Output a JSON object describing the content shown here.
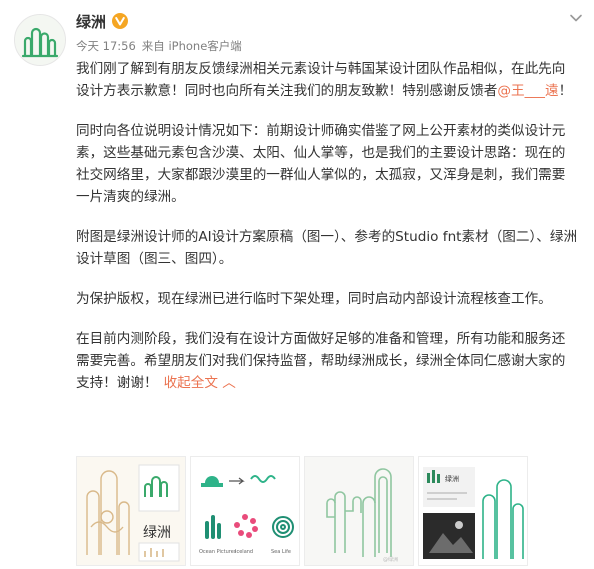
{
  "post": {
    "author": "绿洲",
    "verified_icon": "verified-v-icon",
    "time": "今天 17:56",
    "source": "来自 iPhone客户端",
    "paragraphs": [
      {
        "before": "我们刚了解到有朋友反馈绿洲相关元素设计与韩国某设计团队作品相似，在此先向设计方表示歉意！同时也向所有关注我们的朋友致歉！特别感谢反馈者",
        "mention": "@王___遠",
        "after": "！"
      },
      {
        "text": "同时向各位说明设计情况如下：前期设计师确实借鉴了网上公开素材的类似设计元素，这些基础元素包含沙漠、太阳、仙人掌等，也是我们的主要设计思路：现在的社交网络里，大家都跟沙漠里的一群仙人掌似的，太孤寂，又浑身是刺，我们需要一片清爽的绿洲。"
      },
      {
        "text": "附图是绿洲设计师的AI设计方案原稿（图一）、参考的Studio fnt素材（图二）、绿洲设计草图（图三、图四）。"
      },
      {
        "text": "为保护版权，现在绿洲已进行临时下架处理，同时启动内部设计流程核查工作。"
      },
      {
        "text": "在目前内测阶段，我们没有在设计方面做好足够的准备和管理，所有功能和服务还需要完善。希望朋友们对我们保持监督，帮助绿洲成长，绿洲全体同仁感谢大家的支持！谢谢！",
        "collapse": "收起全文 ︿"
      }
    ]
  },
  "images": {
    "img1_label": "绿洲",
    "img2_labels": [
      "Ocean Pictures",
      "Iceland",
      "Sea Life"
    ],
    "img3_watermark": "@绿洲",
    "img4_label": "绿洲"
  },
  "colors": {
    "brand_green": "#3aa96b",
    "link": "#eb7350",
    "verified": "#f5a623"
  }
}
